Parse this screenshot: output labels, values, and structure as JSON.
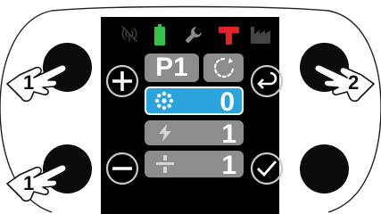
{
  "device": {
    "status_icons": [
      "signal-off-icon",
      "battery-icon",
      "wrench-icon",
      "torque-tool-icon",
      "factory-icon"
    ],
    "colors": {
      "battery": "#35c24a",
      "tool": "#e32228",
      "highlight": "#2ba3dc",
      "panel": "#8d8d8d"
    }
  },
  "screen": {
    "program_label": "P1",
    "rows": [
      {
        "icon": "dots-circle-icon",
        "value": "0",
        "highlighted": true
      },
      {
        "icon": "lightning-icon",
        "value": "1",
        "highlighted": false
      },
      {
        "icon": "split-icon",
        "value": "1",
        "highlighted": false
      }
    ]
  },
  "callouts": {
    "top_left": "1",
    "top_right": "2",
    "bottom_left": "1"
  }
}
